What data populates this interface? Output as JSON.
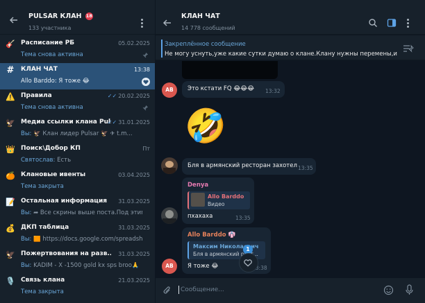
{
  "left": {
    "title": "PULSAR КЛАН",
    "title_badge": "18",
    "subtitle": "133 участника",
    "chats": [
      {
        "icon": "🎸",
        "icon_name": "guitar-icon",
        "name": "Расписание РБ",
        "date": "05.02.2025",
        "who": "",
        "text": "Тема снова активна",
        "pinned": true
      },
      {
        "icon": "#",
        "icon_name": "hashtag-icon",
        "name": "КЛАН ЧАТ",
        "date": "13:38",
        "who": "",
        "text": "Allo Barddo: Я тоже 😂",
        "active": true,
        "heart": true
      },
      {
        "icon": "⚠️",
        "icon_name": "warning-icon",
        "name": "Правила",
        "date": "20.02.2025",
        "ticks": "✓✓",
        "who": "",
        "text": "Тема снова активна",
        "pinned": true
      },
      {
        "icon": "🦅",
        "icon_name": "eagle-icon",
        "name": "Медиа ссылки клана Puls...",
        "date": "31.01.2025",
        "ticks": "✓✓",
        "who": "Вы:",
        "text": "🦅 Клан лидер Pulsar 🦅 ✈ t.m...",
        "pinned": false
      },
      {
        "icon": "👑",
        "icon_name": "crown-icon",
        "name": "Поиск\\Добор КП",
        "date": "Пт",
        "who": "Святослав:",
        "text": "Есть",
        "pinned": false
      },
      {
        "icon": "🍊",
        "icon_name": "events-icon",
        "name": "Клановые ивенты",
        "date": "03.04.2025",
        "who": "",
        "text": "Тема закрыта",
        "pinned": false
      },
      {
        "icon": "📝",
        "icon_name": "memo-icon",
        "name": "Остальная информация",
        "date": "31.03.2025",
        "who": "Вы:",
        "text": "➦ Все скрины выше поста.Под этим ...",
        "pinned": false
      },
      {
        "icon": "💰",
        "icon_name": "money-bag-icon",
        "name": "ДКП таблица",
        "date": "31.03.2025",
        "who": "Вы:",
        "text": "🟧 https://docs.google.com/spreadsh...",
        "pinned": false
      },
      {
        "icon": "🦅",
        "icon_name": "eagle-icon",
        "name": "Пожертвования на разв...",
        "date": "31.03.2025",
        "who": "Вы:",
        "text": "KADIM - X -1500 gold kx sps broo🙏",
        "pinned": false
      },
      {
        "icon": "🎙️",
        "icon_name": "microphone-icon",
        "name": "Связь клана",
        "date": "21.03.2025",
        "who": "",
        "text": "Тема закрыта",
        "pinned": false
      }
    ]
  },
  "right": {
    "title": "КЛАН ЧАТ",
    "subtitle": "14 778 сообщений",
    "pinned_label": "Закреплённое сообщение",
    "pinned_text": "Не могу уснуть,уже какие сутки думаю о клане.Клану нужны перемены,и...",
    "messages": {
      "m1_text": "Это кстати FQ 😂😂😂",
      "m1_time": "13:32",
      "m1_avatar": "AB",
      "sticker": "🤣",
      "m2_text": "Бля в армянский ресторан захотел",
      "m2_time": "13:35",
      "m3_sender": "Denya",
      "m3_reply_name": "Allo Barddo",
      "m3_reply_text": "Видео",
      "m3_text": "пхахаха",
      "m3_time": "13:35",
      "m4_sender": "Allo Barddo",
      "m4_sender_emoji": "👘",
      "m4_reply_name": "Максим Николаевич",
      "m4_reply_text": "Бля в армянский рест...",
      "m4_text": "Я тоже 😂",
      "m4_time": "13:38",
      "m4_avatar": "AB"
    },
    "composer_placeholder": "Сообщение...",
    "unread_reactions": "1"
  },
  "colors": {
    "sidebar_bg": "#17212b",
    "chat_bg": "#0e1621",
    "active_bg": "#2b5278",
    "accent": "#5ea3e6",
    "bubble_bg": "#182533"
  }
}
